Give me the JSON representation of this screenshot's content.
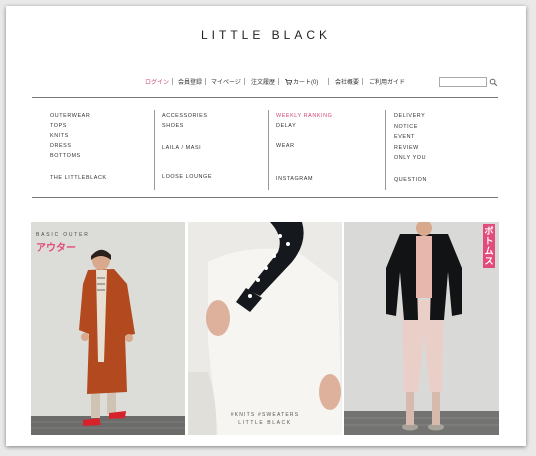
{
  "header": {
    "logo": "LITTLE BLACK"
  },
  "topnav": {
    "login": "ログイン",
    "register": "会員登録",
    "mypage": "マイページ",
    "order_history": "注文履歴",
    "cart": "カート(0)",
    "company": "会社概要",
    "guide": "ご利用ガイド"
  },
  "search": {
    "value": "",
    "placeholder": ""
  },
  "menu": {
    "col1": [
      "OUTERWEAR",
      "TOPS",
      "KNITS",
      "DRESS",
      "BOTTOMS",
      "THE LITTLEBLACK"
    ],
    "col2": [
      "ACCESSORIES",
      "SHOES",
      "LAILA / MASI",
      "LOOSE LOUNGE"
    ],
    "col3": [
      "WEEKLY RANKING",
      "DELAY",
      "WEAR",
      "INSTAGRAM"
    ],
    "col4": [
      "DELIVERY",
      "NOTICE",
      "EVENT",
      "REVIEW",
      "ONLY YOU",
      "QUESTION"
    ]
  },
  "banners": [
    {
      "sub": "BASIC OUTER",
      "title": "アウター"
    },
    {
      "caption_line1": "#KNITS #SWEATERS",
      "caption_line2": "LITTLE BLACK"
    },
    {
      "vertical_label": "ボトムス"
    }
  ],
  "colors": {
    "accent": "#d2477b",
    "label_bg": "#e14c7d",
    "rule": "#777777"
  }
}
